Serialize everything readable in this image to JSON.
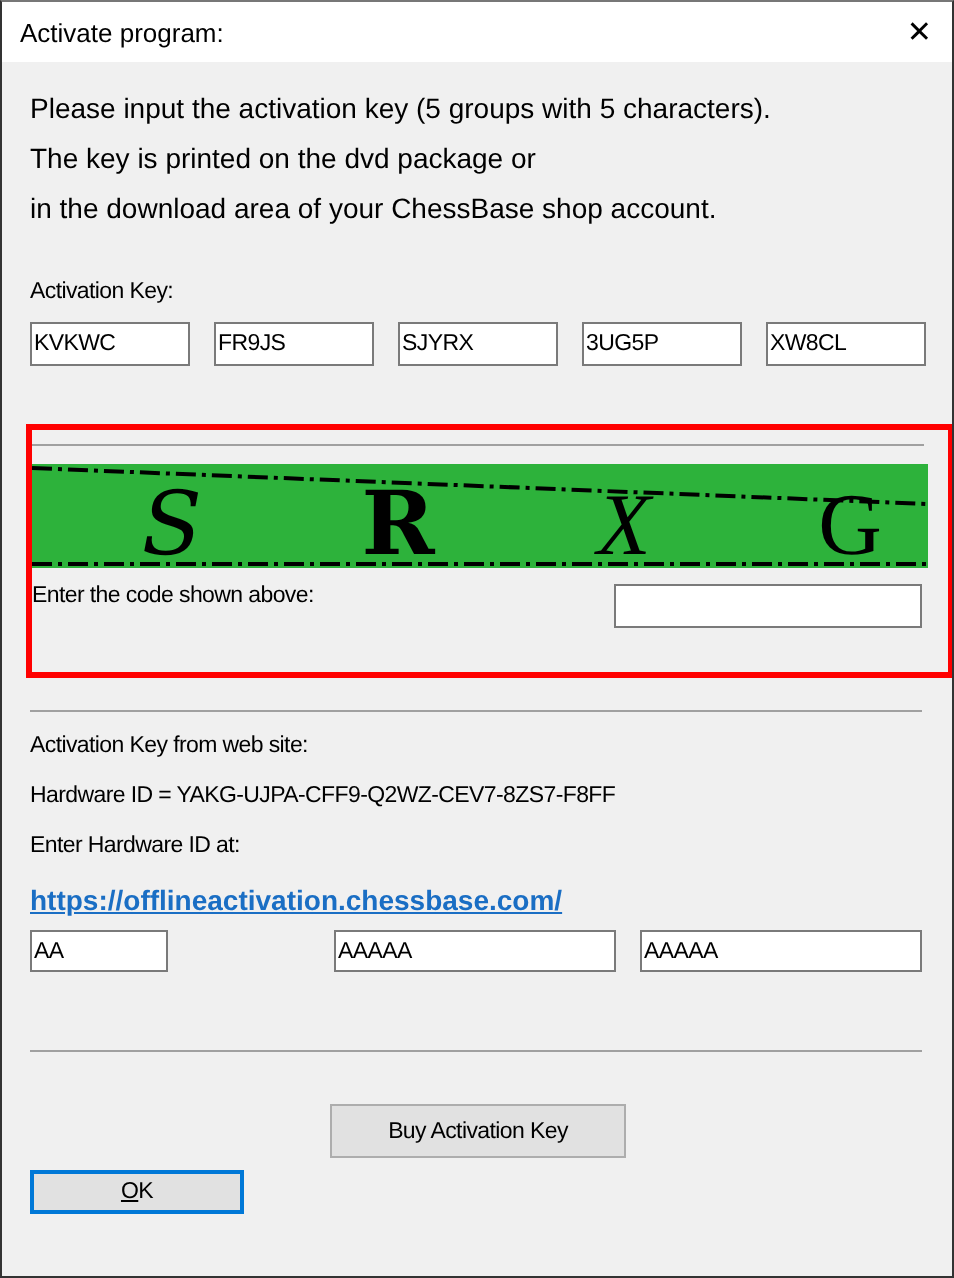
{
  "window": {
    "title": "Activate program:",
    "close": "✕"
  },
  "intro": [
    "Please input the activation key (5 groups with 5 characters).",
    "The key is printed on the dvd package or",
    "in the download area of your ChessBase shop account."
  ],
  "activation_key": {
    "label": "Activation Key:",
    "groups": [
      "KVKWC",
      "FR9JS",
      "SJYRX",
      "3UG5P",
      "XW8CL"
    ]
  },
  "captcha": {
    "highlighted": true,
    "letters": [
      "S",
      "R",
      "X",
      "G"
    ],
    "prompt": "Enter the code shown above:"
  },
  "web": {
    "label": "Activation Key from web site:",
    "hardware_id": "Hardware ID = YAKG-UJPA-CFF9-Q2WZ-CEV7-8ZS7-F8FF",
    "enter_label": "Enter Hardware ID at:",
    "link": "https://offlineactivation.chessbase.com/",
    "fields": [
      "AA",
      "AAAAA",
      "AAAAA"
    ]
  },
  "buttons": [
    {
      "label": "Buy Activation Key",
      "default": false
    },
    {
      "label": "OK",
      "default": true,
      "underline_first": true
    }
  ]
}
